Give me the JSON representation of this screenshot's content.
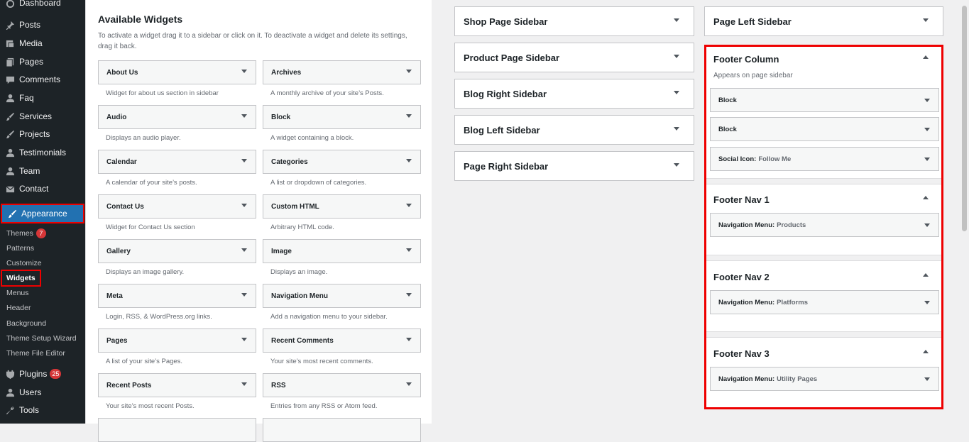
{
  "menu": {
    "dashboard": "Dashboard",
    "posts": "Posts",
    "media": "Media",
    "pages": "Pages",
    "comments": "Comments",
    "faq": "Faq",
    "services": "Services",
    "projects": "Projects",
    "testimonials": "Testimonials",
    "team": "Team",
    "contact": "Contact",
    "appearance": "Appearance",
    "plugins": "Plugins",
    "plugins_badge": "25",
    "users": "Users",
    "tools": "Tools"
  },
  "submenu": {
    "themes": "Themes",
    "themes_badge": "7",
    "patterns": "Patterns",
    "customize": "Customize",
    "widgets": "Widgets",
    "menus": "Menus",
    "header": "Header",
    "background": "Background",
    "theme_setup_wizard": "Theme Setup Wizard",
    "theme_file_editor": "Theme File Editor"
  },
  "available": {
    "title": "Available Widgets",
    "description": "To activate a widget drag it to a sidebar or click on it. To deactivate a widget and delete its settings, drag it back.",
    "widgets": [
      {
        "name": "About Us",
        "desc": "Widget for about us section in sidebar"
      },
      {
        "name": "Archives",
        "desc": "A monthly archive of your site’s Posts."
      },
      {
        "name": "Audio",
        "desc": "Displays an audio player."
      },
      {
        "name": "Block",
        "desc": "A widget containing a block."
      },
      {
        "name": "Calendar",
        "desc": "A calendar of your site’s posts."
      },
      {
        "name": "Categories",
        "desc": "A list or dropdown of categories."
      },
      {
        "name": "Contact Us",
        "desc": "Widget for Contact Us section"
      },
      {
        "name": "Custom HTML",
        "desc": "Arbitrary HTML code."
      },
      {
        "name": "Gallery",
        "desc": "Displays an image gallery."
      },
      {
        "name": "Image",
        "desc": "Displays an image."
      },
      {
        "name": "Meta",
        "desc": "Login, RSS, & WordPress.org links."
      },
      {
        "name": "Navigation Menu",
        "desc": "Add a navigation menu to your sidebar."
      },
      {
        "name": "Pages",
        "desc": "A list of your site’s Pages."
      },
      {
        "name": "Recent Comments",
        "desc": "Your site’s most recent comments."
      },
      {
        "name": "Recent Posts",
        "desc": "Your site’s most recent Posts."
      },
      {
        "name": "RSS",
        "desc": "Entries from any RSS or Atom feed."
      }
    ]
  },
  "sidebars_col1": [
    "Shop Page Sidebar",
    "Product Page Sidebar",
    "Blog Right Sidebar",
    "Blog Left Sidebar",
    "Page Right Sidebar"
  ],
  "sidebars_col2": [
    "Page Left Sidebar"
  ],
  "footer_column": {
    "title": "Footer Column",
    "desc": "Appears on page sidebar",
    "widgets": [
      {
        "name": "Block",
        "sub": ""
      },
      {
        "name": "Block",
        "sub": ""
      },
      {
        "name": "Social Icon:",
        "sub": "Follow Me"
      }
    ]
  },
  "footer_nav1": {
    "title": "Footer Nav 1",
    "widget": "Navigation Menu:",
    "sub": "Products"
  },
  "footer_nav2": {
    "title": "Footer Nav 2",
    "widget": "Navigation Menu:",
    "sub": "Platforms"
  },
  "footer_nav3": {
    "title": "Footer Nav 3",
    "widget": "Navigation Menu:",
    "sub": "Utility Pages"
  },
  "colors": {
    "accent": "#2271b1",
    "highlight": "#ee0000",
    "menu_bg": "#1d2327"
  }
}
